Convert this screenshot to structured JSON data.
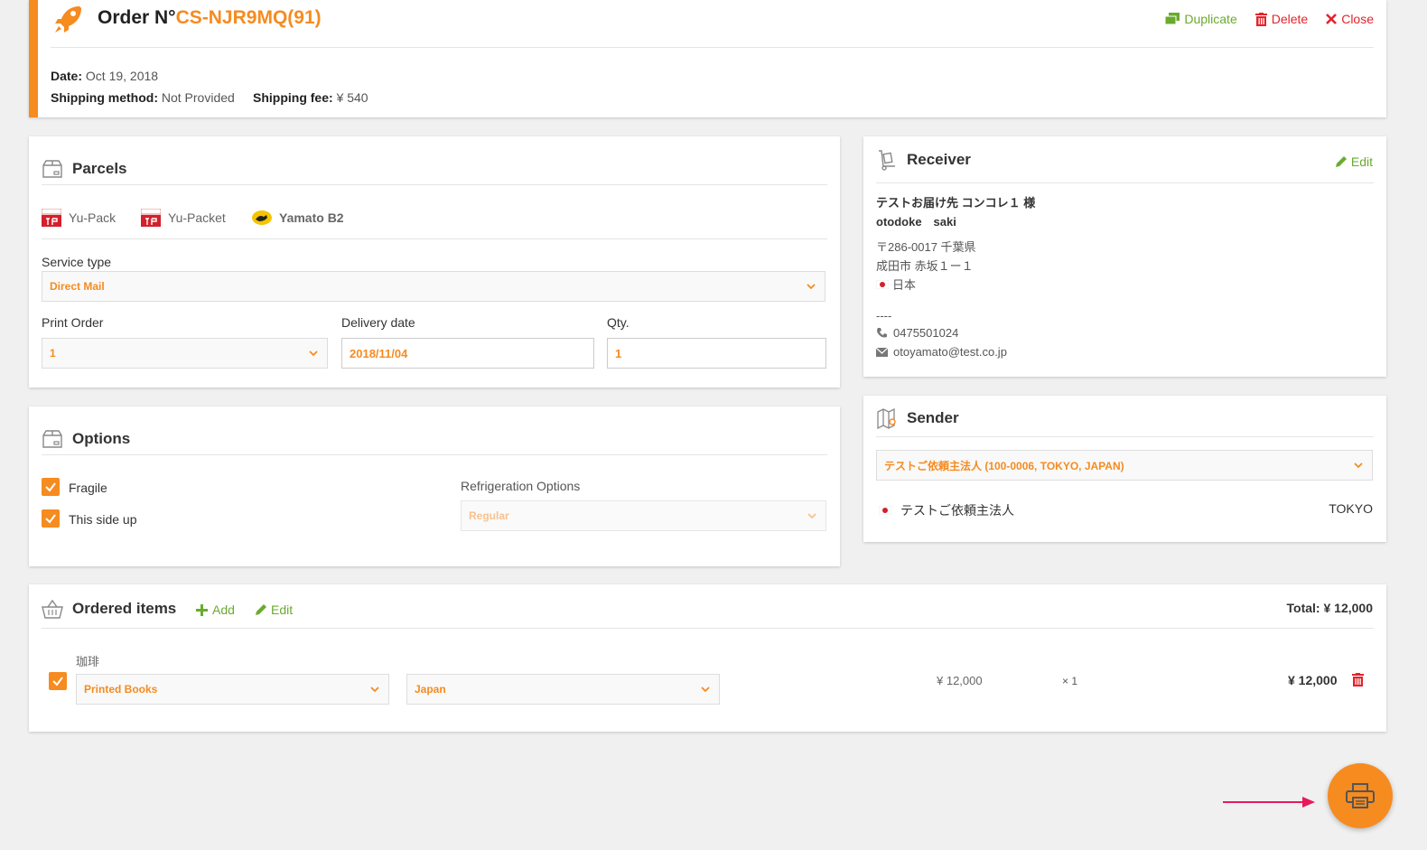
{
  "order": {
    "title_prefix": "Order N°",
    "number": "CS-NJR9MQ(91)",
    "actions": {
      "duplicate": "Duplicate",
      "delete": "Delete",
      "close": "Close"
    },
    "date_label": "Date:",
    "date_value": "Oct 19, 2018",
    "shipping_method_label": "Shipping method:",
    "shipping_method_value": "Not Provided",
    "shipping_fee_label": "Shipping fee:",
    "shipping_fee_value": "¥ 540"
  },
  "parcels": {
    "title": "Parcels",
    "carriers": [
      {
        "name": "Yu-Pack",
        "selected": false
      },
      {
        "name": "Yu-Packet",
        "selected": false
      },
      {
        "name": "Yamato B2",
        "selected": true
      }
    ],
    "service_type_label": "Service type",
    "service_type_value": "Direct Mail",
    "print_order_label": "Print Order",
    "print_order_value": "1",
    "delivery_date_label": "Delivery date",
    "delivery_date_value": "2018/11/04",
    "qty_label": "Qty.",
    "qty_value": "1"
  },
  "options": {
    "title": "Options",
    "fragile_label": "Fragile",
    "fragile_checked": true,
    "side_up_label": "This side up",
    "side_up_checked": true,
    "refrigeration_label": "Refrigeration Options",
    "refrigeration_value": "Regular"
  },
  "receiver": {
    "title": "Receiver",
    "edit_label": "Edit",
    "name_jp": "テストお届け先 コンコレ１ 様",
    "name_en": "otodoke　saki",
    "address_line1": "〒286-0017 千葉県",
    "address_line2": "成田市 赤坂１ー１",
    "country": "日本",
    "dashes": "----",
    "phone": "0475501024",
    "email": "otoyamato@test.co.jp"
  },
  "sender": {
    "title": "Sender",
    "selected": "テストご依頼主法人 (100-0006, TOKYO, JAPAN)",
    "name": "テストご依頼主法人",
    "city": "TOKYO"
  },
  "items": {
    "title": "Ordered items",
    "add_label": "Add",
    "edit_label": "Edit",
    "total_label": "Total:",
    "total_value": "¥ 12,000",
    "rows": [
      {
        "name": "珈琲",
        "checked": true,
        "category": "Printed Books",
        "origin": "Japan",
        "unit_price": "¥ 12,000",
        "qty": "× 1",
        "subtotal": "¥ 12,000"
      }
    ]
  },
  "colors": {
    "accent": "#f68b1f",
    "green": "#6aab2e",
    "red": "#e4232b",
    "arrow": "#e8185a"
  }
}
